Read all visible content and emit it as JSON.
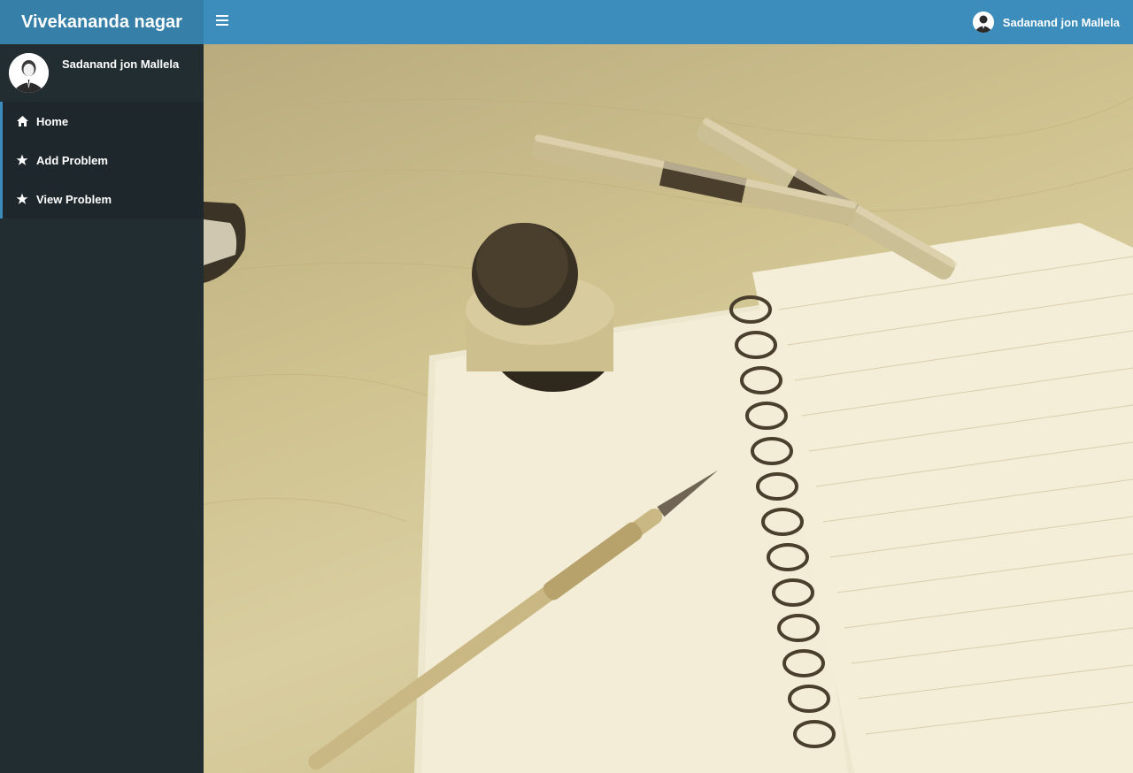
{
  "header": {
    "brand": "Vivekananda nagar",
    "user_name": "Sadanand jon Mallela"
  },
  "sidebar": {
    "user_name": "Sadanand jon Mallela",
    "items": [
      {
        "label": "Home",
        "icon": "home-icon"
      },
      {
        "label": "Add Problem",
        "icon": "star-icon"
      },
      {
        "label": "View Problem",
        "icon": "star-icon"
      }
    ]
  },
  "colors": {
    "header": "#3c8dbc",
    "logo": "#367fa9",
    "sidebar": "#222d32",
    "menu": "#1e282c"
  }
}
